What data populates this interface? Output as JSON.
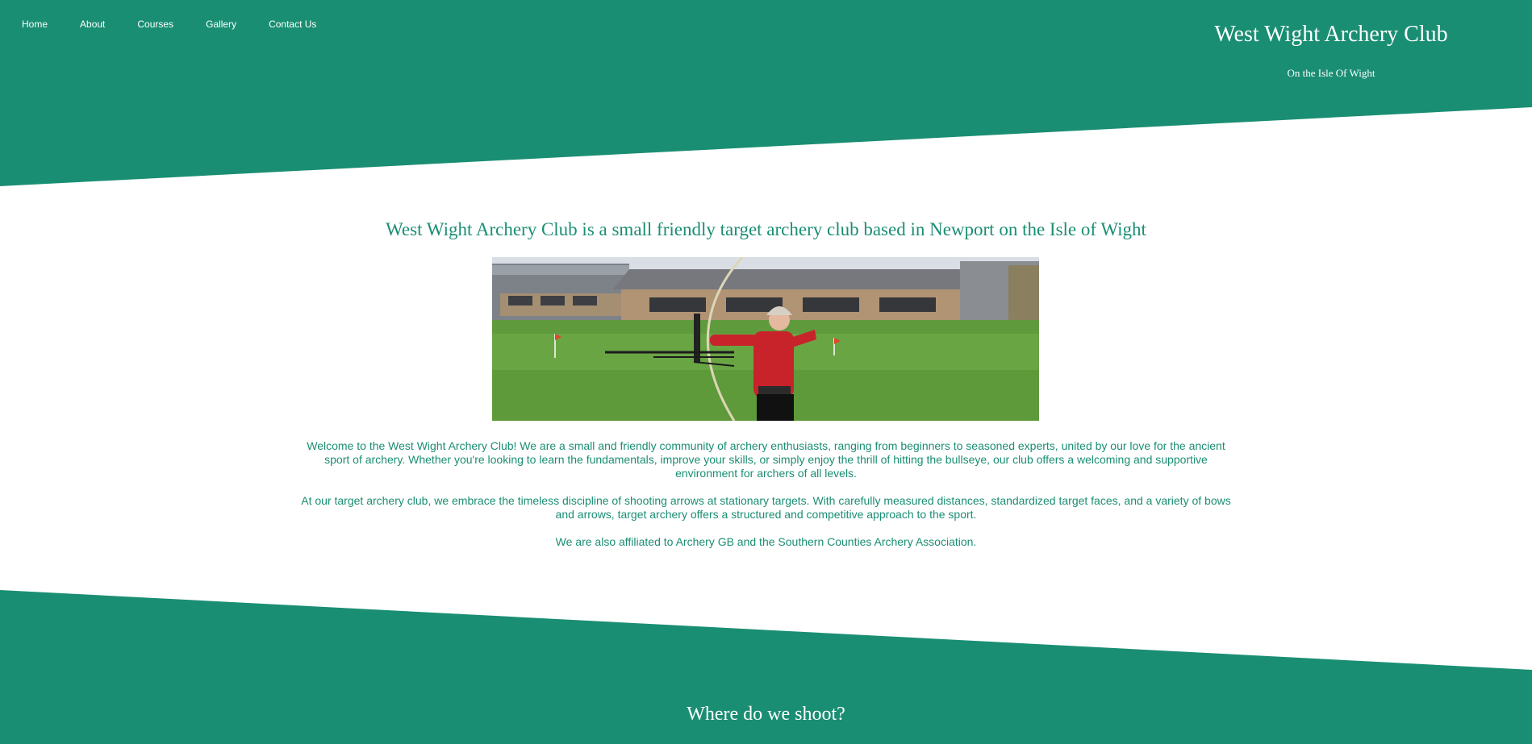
{
  "theme": {
    "primary": "#1a8e73",
    "background": "#ffffff"
  },
  "nav": {
    "items": [
      "Home",
      "About",
      "Courses",
      "Gallery",
      "Contact Us"
    ]
  },
  "header": {
    "title": "West Wight Archery Club",
    "subtitle": "On the Isle Of Wight"
  },
  "main": {
    "heading": "West Wight Archery Club is a small friendly target archery club based in Newport on the Isle of Wight",
    "paragraphs": [
      "Welcome to the West Wight Archery Club! We are a small and friendly community of archery enthusiasts, ranging from beginners to seasoned experts, united by our love for the ancient sport of archery. Whether you're looking to learn the fundamentals, improve your skills, or simply enjoy the thrill of hitting the bullseye, our club offers a welcoming and supportive environment for archers of all levels.",
      "At our target archery club, we embrace the timeless discipline of shooting arrows at stationary targets. With carefully measured distances, standardized target faces, and a variety of bows and arrows, target archery offers a structured and competitive approach to the sport.",
      "We are also affiliated to Archery GB and the Southern Counties Archery Association."
    ]
  },
  "section2": {
    "heading": "Where do we shoot?"
  }
}
